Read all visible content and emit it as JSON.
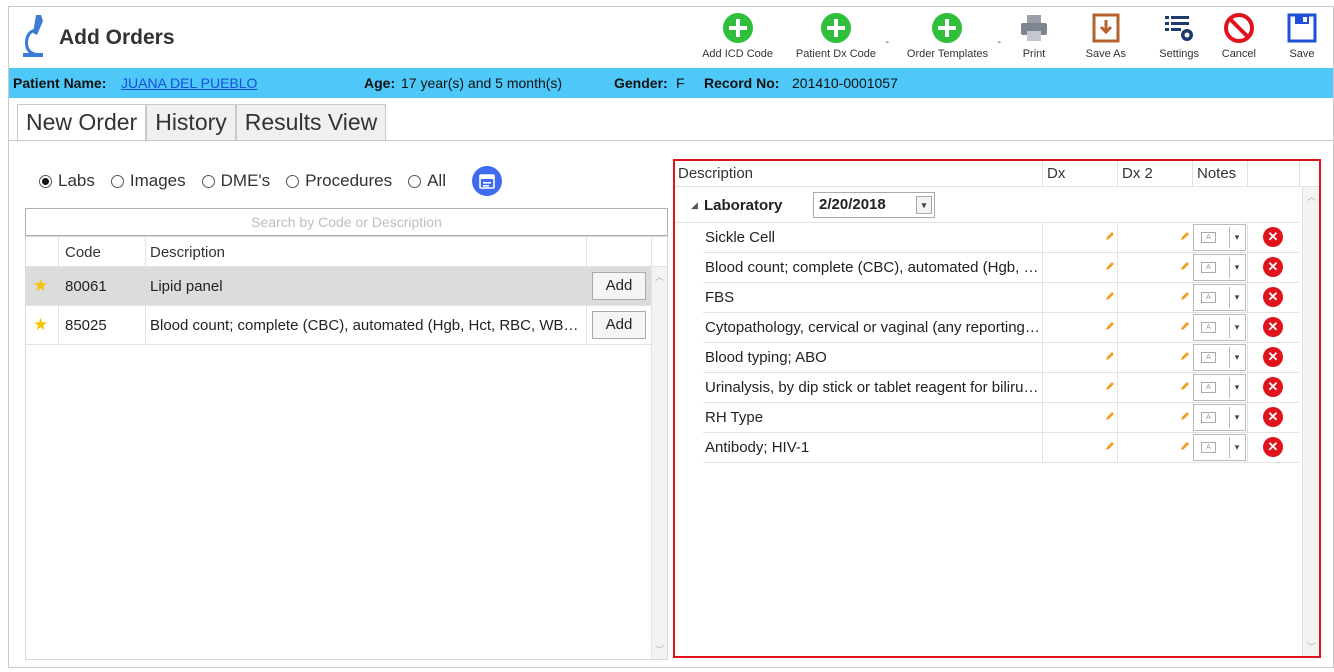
{
  "app": {
    "title": "Add Orders"
  },
  "toolbar": {
    "add_icd": "Add ICD Code",
    "patient_dx": "Patient Dx Code",
    "order_templates": "Order Templates",
    "print": "Print",
    "save_as": "Save As",
    "settings": "Settings",
    "cancel": "Cancel",
    "save": "Save",
    "caret": "-"
  },
  "patient": {
    "name_label": "Patient Name:",
    "name": "JUANA DEL PUEBLO",
    "age_label": "Age:",
    "age": "17 year(s) and 5 month(s)",
    "gender_label": "Gender:",
    "gender": "F",
    "record_label": "Record No:",
    "record": "201410-0001057"
  },
  "tabs": [
    {
      "label": "New Order"
    },
    {
      "label": "History"
    },
    {
      "label": "Results View"
    }
  ],
  "filters": [
    {
      "label": "Labs",
      "checked": true
    },
    {
      "label": "Images"
    },
    {
      "label": "DME's"
    },
    {
      "label": "Procedures"
    },
    {
      "label": "All"
    }
  ],
  "search": {
    "placeholder": "Search by Code or Description"
  },
  "left_grid": {
    "headers": {
      "code": "Code",
      "description": "Description"
    },
    "rows": [
      {
        "code": "80061",
        "description": "Lipid panel",
        "action": "Add"
      },
      {
        "code": "85025",
        "description": "Blood count; complete (CBC), automated (Hgb, Hct, RBC, WBC and platelet count)",
        "action": "Add"
      }
    ]
  },
  "right_grid": {
    "headers": {
      "description": "Description",
      "dx": "Dx",
      "dx2": "Dx 2",
      "notes": "Notes"
    },
    "group": {
      "label": "Laboratory",
      "date": "2/20/2018"
    },
    "orders": [
      {
        "description": "Sickle Cell"
      },
      {
        "description": "Blood count; complete (CBC), automated (Hgb, Hct, RBC, WBC and platelet count)"
      },
      {
        "description": "FBS"
      },
      {
        "description": "Cytopathology, cervical or vaginal (any reporting system)"
      },
      {
        "description": "Blood typing; ABO"
      },
      {
        "description": "Urinalysis, by dip stick or tablet reagent for bilirubin"
      },
      {
        "description": "RH Type"
      },
      {
        "description": "Antibody; HIV-1"
      }
    ]
  },
  "colors": {
    "patient_bar": "#4ec8f9",
    "accent_green": "#2fbf3a",
    "highlight_border": "#e0131c",
    "link": "#1a4fd6"
  }
}
